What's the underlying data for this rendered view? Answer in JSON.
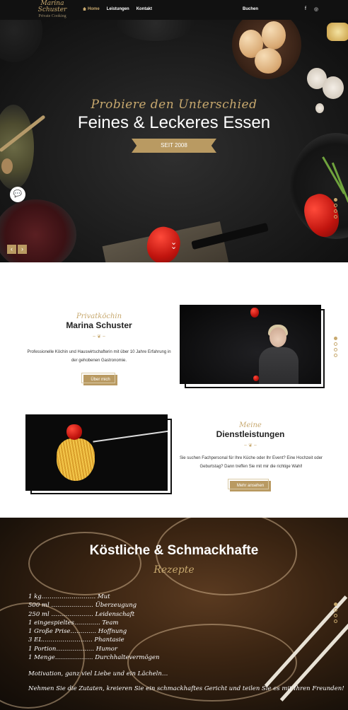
{
  "nav": {
    "logo_line1": "Marina",
    "logo_line2": "Schuster",
    "logo_line3": "Private Cooking",
    "items": [
      "Home",
      "Leistungen",
      "Kontakt"
    ],
    "cta": "Buchen",
    "social": [
      "f",
      "◎"
    ]
  },
  "hero": {
    "script": "Probiere den Unterschied",
    "title": "Feines & Leckeres Essen",
    "badge": "SEIT 2008"
  },
  "about": {
    "script": "Privatköchin",
    "title": "Marina Schuster",
    "text_line1": "Professionelle Köchin und Hauswirtschafterin mit über 10 Jahre Erfahrung in",
    "text_line2": "der gehobenen Gastronomie.",
    "button": "Über mich"
  },
  "services": {
    "script": "Meine",
    "title": "Dienstleistungen",
    "text_line1": "Sie suchen Fachpersonal für Ihre Küche oder Ihr Event? Eine Hochzeit oder",
    "text_line2": "Geburtstag? Dann treffen Sie mit mir die richtige Wahl!",
    "button": "Mehr ansehen"
  },
  "recipe": {
    "title": "Köstliche & Schmackhafte",
    "script": "Rezepte",
    "ingredients": [
      "1 kg……………………… Mut",
      "500 ml ………………… Überzeugung",
      "250 ml ………………… Leidenschaft",
      "1 eingespieltes…………. Team",
      "1 Große Prise…………. Hoffnung",
      "3 EL……………………. Phantasie",
      "1 Portion………………. Humor",
      "1 Menge………………. Durchhaltevermögen"
    ],
    "motto": "Motivation, ganz viel Liebe und ein Lächeln…",
    "closing": "Nehmen Sie die Zutaten, kreieren Sie ein schmackhaftes Gericht und teilen Sie es mit Ihren Freunden!"
  },
  "colors": {
    "gold": "#b99a62",
    "script_gold": "#c7a86e",
    "nav_bg": "#111111"
  }
}
